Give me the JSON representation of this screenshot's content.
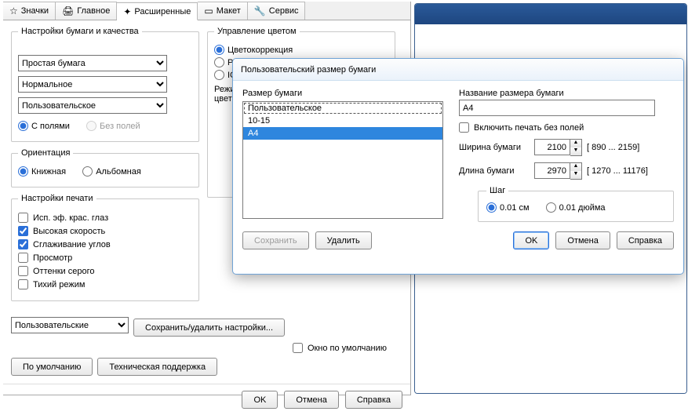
{
  "tabs": {
    "icons": {
      "label": "Значки",
      "glyph": "☆"
    },
    "main": {
      "label": "Главное",
      "glyph": "🖨"
    },
    "advanced": {
      "label": "Расширенные",
      "glyph": "✦"
    },
    "layout": {
      "label": "Макет",
      "glyph": "▭"
    },
    "service": {
      "label": "Сервис",
      "glyph": "🔧"
    }
  },
  "paper": {
    "legend": "Настройки бумаги и качества",
    "type": "Простая бумага",
    "quality": "Нормальное",
    "size": "Пользовательское",
    "withMargins": "С полями",
    "borderless": "Без полей"
  },
  "orientation": {
    "legend": "Ориентация",
    "portrait": "Книжная",
    "landscape": "Альбомная"
  },
  "printSettings": {
    "legend": "Настройки печати",
    "redeye": "Исп. эф. крас. глаз",
    "speed": "Высокая скорость",
    "smooth": "Сглаживание углов",
    "preview": "Просмотр",
    "gray": "Оттенки серого",
    "quiet": "Тихий режим"
  },
  "color": {
    "legend": "Управление цветом",
    "correction": "Цветокоррекция",
    "photo": "Pho",
    "icm": "ICM",
    "modeLabel": "Режи",
    "modeLabel2": "цвет"
  },
  "bottom": {
    "preset": "Пользовательские",
    "savePreset": "Сохранить/удалить настройки...",
    "defaultWin": "Окно по умолчанию",
    "defaults": "По умолчанию",
    "support": "Техническая поддержка",
    "ok": "OK",
    "cancel": "Отмена",
    "help": "Справка"
  },
  "modal": {
    "title": "Пользовательский размер бумаги",
    "sizeLabel": "Размер бумаги",
    "sizes": [
      "Пользовательское",
      "10-15",
      "A4"
    ],
    "selectedIdx": 2,
    "nameLabel": "Название размера бумаги",
    "nameValue": "A4",
    "borderless": "Включить печать без полей",
    "widthLabel": "Ширина бумаги",
    "widthValue": "2100",
    "widthRange": "[ 890 ... 2159]",
    "heightLabel": "Длина бумаги",
    "heightValue": "2970",
    "heightRange": "[ 1270 ... 11176]",
    "stepLegend": "Шаг",
    "stepCm": "0.01 см",
    "stepIn": "0.01 дюйма",
    "save": "Сохранить",
    "delete": "Удалить",
    "ok": "OK",
    "cancel": "Отмена",
    "help": "Справка"
  }
}
